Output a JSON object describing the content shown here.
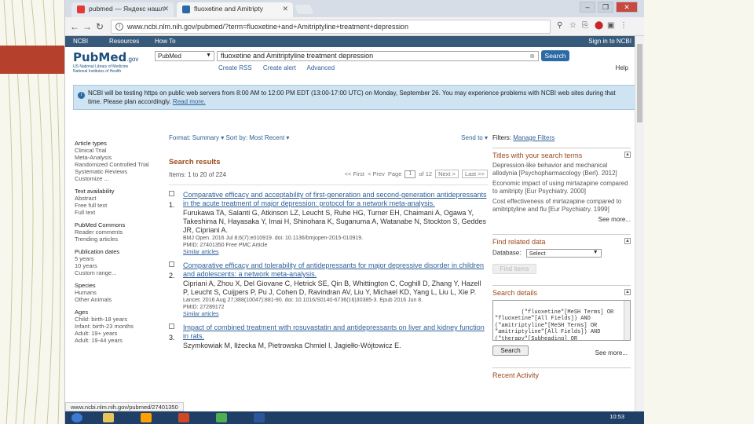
{
  "browser": {
    "tab_inactive": "pubmed — Яндекс нашл",
    "tab_active": "fluoxetine and Amitripty",
    "url": "www.ncbi.nlm.nih.gov/pubmed/?term=fluoxetine+and+Amitriptyline+treatment+depression",
    "status_url": "www.ncbi.nlm.nih.gov/pubmed/27401350"
  },
  "ncbi_bar": {
    "ncbi": "NCBI",
    "resources": "Resources",
    "howto": "How To",
    "signin": "Sign in to NCBI"
  },
  "pubmed": {
    "logo_main": "PubMed",
    "logo_gov": ".gov",
    "logo_sub1": "US National Library of Medicine",
    "logo_sub2": "National Institutes of Health",
    "db": "PubMed",
    "query": "fluoxetine and Amitriptyline treatment depression",
    "search_label": "Search",
    "create_rss": "Create RSS",
    "create_alert": "Create alert",
    "advanced": "Advanced",
    "help": "Help"
  },
  "alert": {
    "text": "NCBI will be testing https on public web servers from 8:00 AM to 12:00 PM EDT (13:00-17:00 UTC) on Monday, September 26. You may experience problems with NCBI web sites during that time. Please plan accordingly.",
    "read_more": "Read more."
  },
  "filters_left": [
    {
      "head": "Article types",
      "links": [
        "Clinical Trial",
        "Meta-Analysis",
        "Randomized Controlled Trial",
        "Systematic Reviews",
        "Customize ..."
      ]
    },
    {
      "head": "Text availability",
      "links": [
        "Abstract",
        "Free full text",
        "Full text"
      ]
    },
    {
      "head": "PubMed Commons",
      "links": [
        "Reader comments",
        "Trending articles"
      ]
    },
    {
      "head": "Publication dates",
      "links": [
        "5 years",
        "10 years",
        "Custom range..."
      ]
    },
    {
      "head": "Species",
      "links": [
        "Humans",
        "Other Animals"
      ]
    },
    {
      "head": "Ages",
      "links": [
        "Child: birth-18 years",
        "Infant: birth-23 months",
        "Adult: 19+ years",
        "Adult: 19-44 years"
      ]
    }
  ],
  "results": {
    "format": "Format: Summary ▾  Sort by: Most Recent ▾",
    "sendto": "Send to ▾",
    "title": "Search results",
    "items": "Items: 1 to 20 of 224",
    "first": "<< First",
    "prev": "< Prev",
    "page_label": "Page",
    "page_value": "1",
    "of": "of 12",
    "next": "Next >",
    "last": "Last >>",
    "list": [
      {
        "num": "1.",
        "title": "Comparative efficacy and acceptability of first-generation and second-generation antidepressants in the acute treatment of major depression: protocol for a network meta-analysis.",
        "authors": "Furukawa TA, Salanti G, Atkinson LZ, Leucht S, Ruhe HG, Turner EH, Chaimani A, Ogawa Y, Takeshima N, Hayasaka Y, Imai H, Shinohara K, Suganuma A, Watanabe N, Stockton S, Geddes JR, Cipriani A.",
        "cite": "BMJ Open. 2016 Jul 8;6(7):e010919. doi: 10.1136/bmjopen-2015-010919.",
        "pmid": "PMID: 27401350    Free PMC Article",
        "similar": "Similar articles"
      },
      {
        "num": "2.",
        "title": "Comparative efficacy and tolerability of antidepressants for major depressive disorder in children and adolescents: a network meta-analysis.",
        "authors": "Cipriani A, Zhou X, Del Giovane C, Hetrick SE, Qin B, Whittington C, Coghill D, Zhang Y, Hazell P, Leucht S, Cuijpers P, Pu J, Cohen D, Ravindran AV, Liu Y, Michael KD, Yang L, Liu L, Xie P.",
        "cite": "Lancet. 2016 Aug 27;388(10047):881-90. doi: 10.1016/S0140-6736(16)30385-3. Epub 2016 Jun 8.",
        "pmid": "PMID: 27289172",
        "similar": "Similar articles"
      },
      {
        "num": "3.",
        "title": "Impact of combined treatment with rosuvastatin and antidepressants on liver and kidney function in rats.",
        "authors": "Szymkowiak M, Iłżecka M, Pietrowska Chmiel I, Jagiełło-Wójtowicz E.",
        "cite": "",
        "pmid": "",
        "similar": ""
      }
    ]
  },
  "right": {
    "filters_label": "Filters:",
    "manage_filters": "Manage Filters",
    "titles_head": "Titles with your search terms",
    "titles": [
      "Depression-like behavior and mechanical allodynia [Psychopharmacology (Berl). 2012]",
      "Economic impact of using mirtazapine compared to amitripty [Eur Psychiatry. 2000]",
      "Cost effectiveness of mirtazapine compared to amitriptyline and flu [Eur Psychiatry. 1999]"
    ],
    "see_more": "See more...",
    "related_head": "Find related data",
    "database_label": "Database:",
    "database_value": "Select",
    "find_items": "Find items",
    "details_head": "Search details",
    "details_text": "(\"fluoxetine\"[MeSH Terms] OR\n\"fluoxetine\"[All Fields]) AND\n(\"amitriptyline\"[MeSH Terms] OR\n\"amitriptyline\"[All Fields]) AND\n(\"therapy\"[Subheading] OR",
    "search_btn": "Search",
    "see_more2": "See more...",
    "recent_head": "Recent Activity"
  },
  "taskbar": {
    "clock": "10:53"
  }
}
